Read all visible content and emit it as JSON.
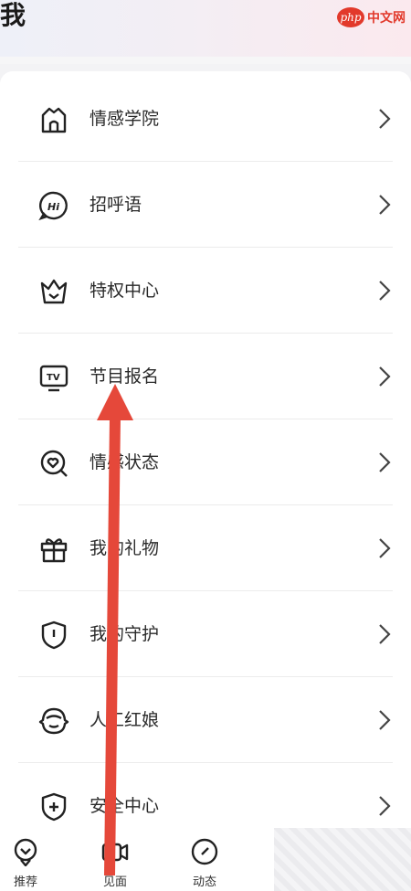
{
  "header": {
    "title": "我"
  },
  "watermark": {
    "brand": "php",
    "site": "中文网"
  },
  "menu": {
    "items": [
      {
        "label": "情感学院",
        "icon": "school-icon"
      },
      {
        "label": "招呼语",
        "icon": "hi-bubble-icon"
      },
      {
        "label": "特权中心",
        "icon": "crown-icon"
      },
      {
        "label": "节目报名",
        "icon": "tv-icon"
      },
      {
        "label": "情感状态",
        "icon": "heart-search-icon"
      },
      {
        "label": "我的礼物",
        "icon": "gift-icon"
      },
      {
        "label": "我的守护",
        "icon": "shield-alert-icon"
      },
      {
        "label": "人工红娘",
        "icon": "matchmaker-icon"
      },
      {
        "label": "安全中心",
        "icon": "shield-plus-icon"
      }
    ]
  },
  "bottom_nav": {
    "items": [
      {
        "label": "推荐",
        "icon": "recommend-icon"
      },
      {
        "label": "见面",
        "icon": "video-camera-icon"
      },
      {
        "label": "动态",
        "icon": "compass-icon"
      }
    ]
  },
  "colors": {
    "annotation_arrow": "#e5483a",
    "accent": "#e2392b"
  }
}
